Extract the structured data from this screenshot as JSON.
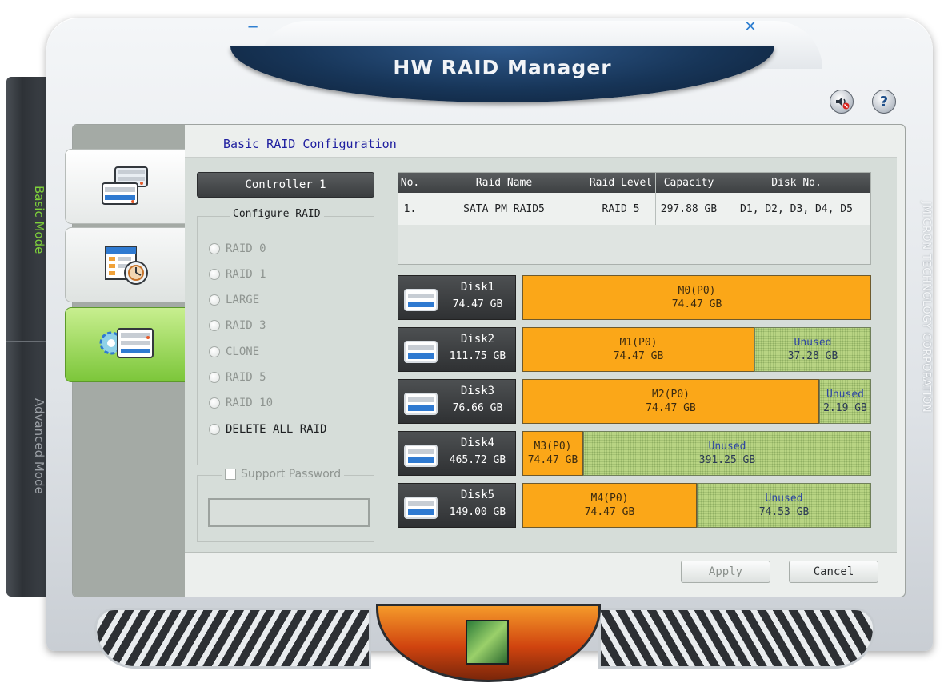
{
  "app": {
    "title": "HW RAID Manager",
    "vendor": "JMICRON TECHNOLOGY CORPORATION",
    "minimize_label": "−",
    "close_label": "✕",
    "help_label": "?"
  },
  "modes": {
    "basic": "Basic Mode",
    "advanced": "Advanced Mode"
  },
  "section": {
    "title": "Basic RAID Configuration"
  },
  "controller": {
    "label": "Controller 1"
  },
  "configure": {
    "legend": "Configure RAID",
    "options": [
      "RAID 0",
      "RAID 1",
      "LARGE",
      "RAID 3",
      "CLONE",
      "RAID 5",
      "RAID 10",
      "DELETE ALL RAID"
    ],
    "enabled": [
      false,
      false,
      false,
      false,
      false,
      false,
      false,
      true
    ]
  },
  "password": {
    "label": "Support Password",
    "checked": false,
    "value": ""
  },
  "table": {
    "headers": [
      "No.",
      "Raid Name",
      "Raid Level",
      "Capacity",
      "Disk No."
    ],
    "rows": [
      [
        "1.",
        "SATA PM RAID5",
        "RAID 5",
        "297.88 GB",
        "D1, D2, D3, D4, D5"
      ]
    ]
  },
  "disks": [
    {
      "name": "Disk1",
      "size": "74.47 GB",
      "segments": [
        {
          "label": "M0(P0)",
          "size": "74.47 GB",
          "type": "used",
          "fraction": 1.0
        }
      ]
    },
    {
      "name": "Disk2",
      "size": "111.75 GB",
      "segments": [
        {
          "label": "M1(P0)",
          "size": "74.47 GB",
          "type": "used",
          "fraction": 0.666
        },
        {
          "label": "Unused",
          "size": "37.28 GB",
          "type": "unused",
          "fraction": 0.334
        }
      ]
    },
    {
      "name": "Disk3",
      "size": "76.66 GB",
      "segments": [
        {
          "label": "M2(P0)",
          "size": "74.47 GB",
          "type": "used",
          "fraction": 0.85
        },
        {
          "label": "Unused",
          "size": "2.19 GB",
          "type": "unused",
          "fraction": 0.15
        }
      ]
    },
    {
      "name": "Disk4",
      "size": "465.72 GB",
      "segments": [
        {
          "label": "M3(P0)",
          "size": "74.47 GB",
          "type": "used",
          "fraction": 0.175
        },
        {
          "label": "Unused",
          "size": "391.25 GB",
          "type": "unused",
          "fraction": 0.825
        }
      ]
    },
    {
      "name": "Disk5",
      "size": "149.00 GB",
      "segments": [
        {
          "label": "M4(P0)",
          "size": "74.47 GB",
          "type": "used",
          "fraction": 0.5
        },
        {
          "label": "Unused",
          "size": "74.53 GB",
          "type": "unused",
          "fraction": 0.5
        }
      ]
    }
  ],
  "buttons": {
    "apply": "Apply",
    "cancel": "Cancel"
  },
  "colors": {
    "used_segment": "#fba718",
    "unused_segment": "#b8d483",
    "active_mode": "#7fd33b",
    "title_bar": "#173558"
  },
  "icons": {
    "tab1": "raid-disks-icon",
    "tab2": "raid-schedule-icon",
    "tab3": "raid-settings-icon",
    "sound": "speaker-mute-icon",
    "help": "help-icon"
  }
}
